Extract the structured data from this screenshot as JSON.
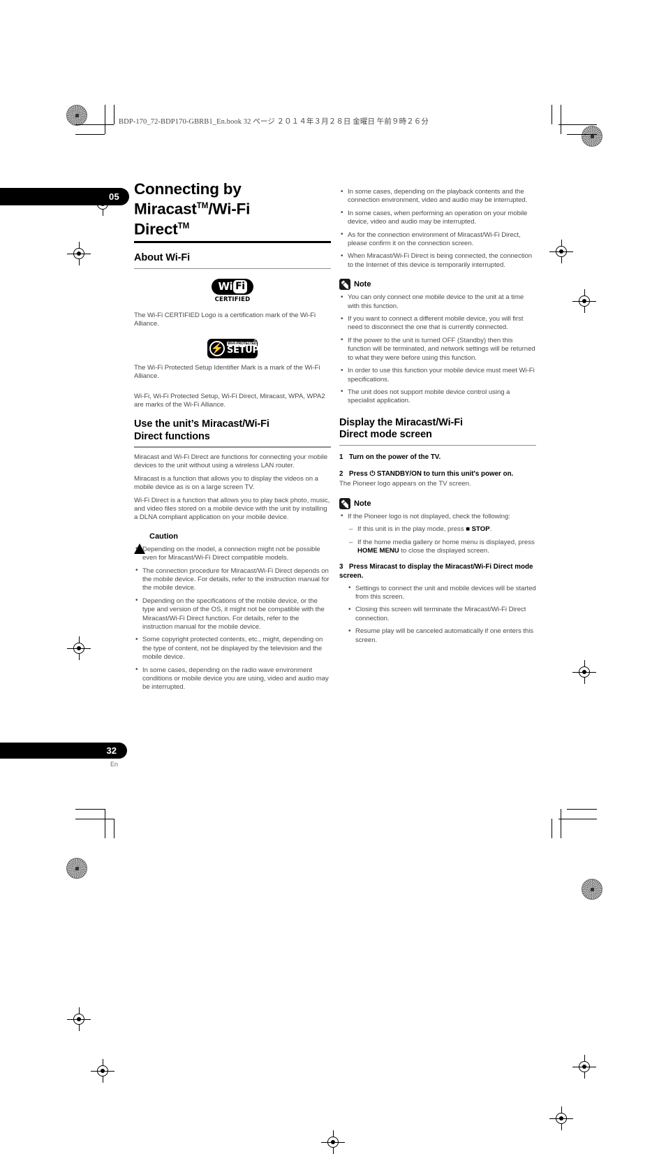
{
  "header": {
    "slug": "BDP-170_72-BDP170-GBRB1_En.book   32 ページ   ２０１４年３月２８日   金曜日   午前９時２６分"
  },
  "chapter": {
    "number": "05"
  },
  "footer": {
    "page_number": "32",
    "language": "En"
  },
  "title": {
    "line1": "Connecting by",
    "line2_main": "Miracast",
    "line2_sup": "TM",
    "line2_rest": "/Wi-Fi",
    "line3_main": "Direct",
    "line3_sup": "TM"
  },
  "about_wifi": {
    "heading": "About Wi-Fi",
    "wifi_logo": {
      "wi": "Wi",
      "fi": "Fi",
      "certified": "CERTIFIED"
    },
    "wifi_caption": "The Wi-Fi CERTIFIED Logo is a certification mark of the Wi-Fi Alliance.",
    "wps_logo": {
      "small_text": "WI-FI PROTECTED",
      "setup": "SETUP",
      "tm": "®"
    },
    "wps_caption": "The Wi-Fi Protected Setup Identifier Mark is a mark of the Wi-Fi Alliance.",
    "marks_caption": "Wi-Fi, Wi-Fi Protected Setup, Wi-Fi Direct, Miracast, WPA, WPA2 are marks of the Wi-Fi Alliance."
  },
  "use_functions": {
    "heading_line1": "Use the unit’s Miracast/Wi-Fi",
    "heading_line2": "Direct functions",
    "paragraphs": [
      "Miracast and Wi-Fi Direct are functions for connecting your mobile devices to the unit without using a wireless LAN router.",
      "Miracast is a function that allows you to display the videos on a mobile device as is on a large screen TV.",
      "Wi-Fi Direct is a function that allows you to play back photo, music, and video files stored on a mobile device with the unit by installing a DLNA compliant application on your mobile device."
    ]
  },
  "caution": {
    "label": "Caution",
    "items": [
      "Depending on the model, a connection might not be possible even for Miracast/Wi-Fi Direct compatible models.",
      "The connection procedure for Miracast/Wi-Fi Direct depends on the mobile device. For details, refer to the instruction manual for the mobile device.",
      "Depending on the specifications of the mobile device, or the type and version of the OS, it might not be compatible with the Miracast/Wi-Fi Direct function. For details, refer to the instruction manual for the mobile device.",
      "Some copyright protected contents, etc., might, depending on the type of content, not be displayed by the television and the mobile device.",
      "In some cases, depending on the radio wave environment conditions or mobile device you are using, video and audio may be interrupted.",
      "In some cases, depending on the playback contents and the connection environment, video and audio may be interrupted.",
      "In some cases, when performing an operation on your mobile device, video and audio may be interrupted.",
      "As for the connection environment of Miracast/Wi-Fi Direct, please confirm it on the connection screen.",
      "When Miracast/Wi-Fi Direct is being connected, the connection to the Internet of this device is temporarily interrupted."
    ]
  },
  "note_one": {
    "label": "Note",
    "items": [
      "You can only connect one mobile device to the unit at a time with this function.",
      "If you want to connect a different mobile device, you will first need to disconnect the one that is currently connected.",
      "If the power to the unit is turned OFF (Standby) then this function will be terminated, and network settings will be returned to what they were before using this function.",
      "In order to use this function your mobile device must meet Wi-Fi specifications.",
      "The unit does not support mobile device control using a specialist application."
    ]
  },
  "display_mode": {
    "heading_line1": "Display the Miracast/Wi-Fi",
    "heading_line2": "Direct mode screen",
    "step1": {
      "num": "1",
      "text": "Turn on the power of the TV."
    },
    "step2": {
      "num": "2",
      "text_before": "Press",
      "power_symbol": "⏻",
      "text_after": "STANDBY/ON to turn this unit's power on.",
      "note": "The Pioneer logo appears on the TV screen."
    },
    "step3": {
      "num": "3",
      "text": "Press Miracast to display the Miracast/Wi-Fi Direct mode screen.",
      "items": [
        "Settings to connect the unit and mobile devices will be started from this screen.",
        "Closing this screen will terminate the Miracast/Wi-Fi Direct connection.",
        "Resume play will be canceled automatically if one enters this screen."
      ]
    }
  },
  "note_two": {
    "label": "Note",
    "lead": "If the Pioneer logo is not displayed, check the following:",
    "sub_items": [
      {
        "before": "If this unit is in the play mode, press",
        "key_symbol": "■",
        "key": "STOP",
        "after": "."
      },
      {
        "before": "If the home media gallery or home menu is displayed, press",
        "key": "HOME MENU",
        "after": "to close the displayed screen."
      }
    ]
  }
}
